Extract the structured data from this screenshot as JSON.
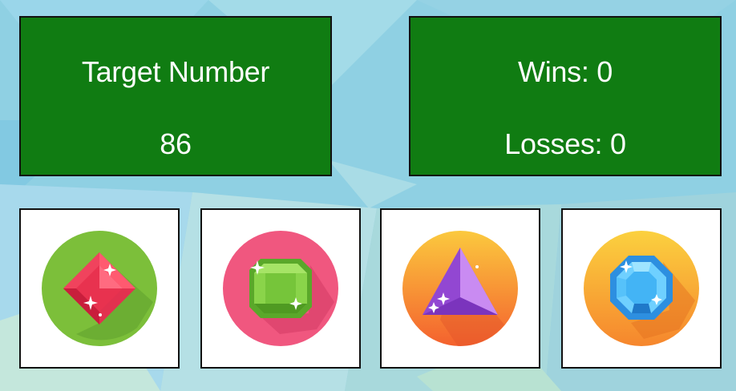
{
  "target": {
    "label": "Target Number",
    "value": "86"
  },
  "score": {
    "wins_text": "Wins: 0",
    "losses_text": "Losses: 0"
  },
  "crystals": [
    {
      "icon": "red-diamond-gem-icon",
      "circle_color": "#7cbf3a",
      "gem_color": "#e2314f"
    },
    {
      "icon": "green-emerald-gem-icon",
      "circle_color": "#f0577f",
      "gem_color": "#76c53a"
    },
    {
      "icon": "purple-triangle-gem-icon",
      "circle_color": "#f7963a",
      "gem_color": "#a55de0"
    },
    {
      "icon": "blue-octagon-gem-icon",
      "circle_color": "#f7a52f",
      "gem_color": "#3fa9f0"
    }
  ]
}
